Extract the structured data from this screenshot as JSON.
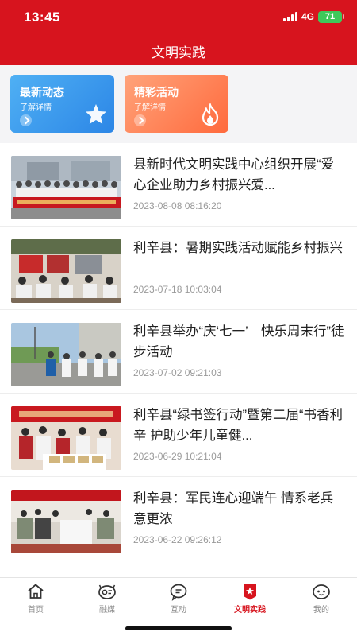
{
  "status": {
    "time": "13:45",
    "network": "4G",
    "battery": "71"
  },
  "header": {
    "title": "文明实践"
  },
  "cards": [
    {
      "title": "最新动态",
      "subtitle": "了解详情",
      "icon": "star-icon"
    },
    {
      "title": "精彩活动",
      "subtitle": "了解详情",
      "icon": "flame-icon"
    }
  ],
  "news": [
    {
      "title": "县新时代文明实践中心组织开展“爱心企业助力乡村振兴爱...",
      "date": "2023-08-08 08:16:20"
    },
    {
      "title": "利辛县：暑期实践活动赋能乡村振兴",
      "date": "2023-07-18 10:03:04"
    },
    {
      "title": "利辛县举办“庆‘七一’　快乐周末行”徒步活动",
      "date": "2023-07-02 09:21:03"
    },
    {
      "title": "利辛县“绿书签行动”暨第二届“书香利辛 护助少年儿童健...",
      "date": "2023-06-29 10:21:04"
    },
    {
      "title": "利辛县：军民连心迎端午 情系老兵意更浓",
      "date": "2023-06-22 09:26:12"
    }
  ],
  "tabs": [
    {
      "label": "首页",
      "icon": "home-icon"
    },
    {
      "label": "融媒",
      "icon": "media-icon"
    },
    {
      "label": "互动",
      "icon": "chat-icon"
    },
    {
      "label": "文明实践",
      "icon": "star-badge-icon",
      "active": true
    },
    {
      "label": "我的",
      "icon": "profile-icon"
    }
  ],
  "colors": {
    "brand": "#d7141e",
    "card_blue": "#3b9cf0",
    "card_orange": "#ff7a4a"
  }
}
